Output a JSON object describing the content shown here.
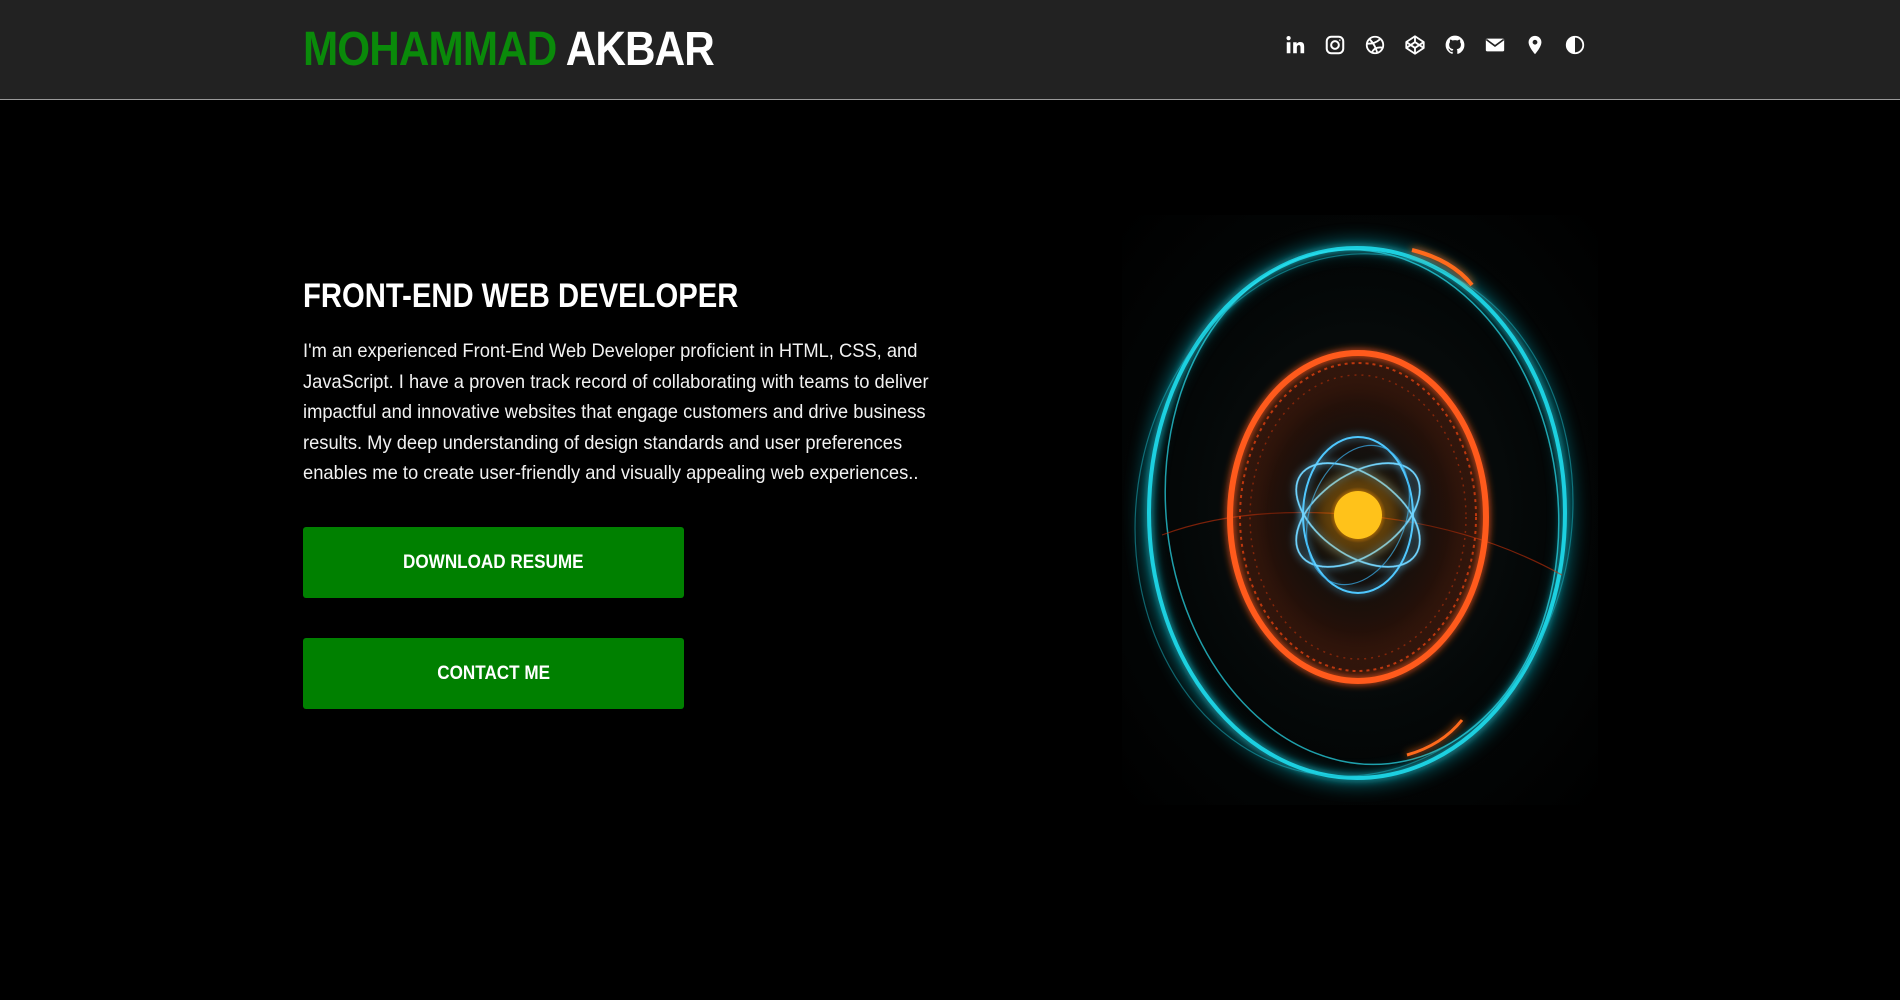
{
  "header": {
    "brand_first": "MOHAMMAD",
    "brand_last": "AKBAR",
    "brand_first_color": "#0a8a0a",
    "icons": [
      "linkedin-icon",
      "instagram-icon",
      "dribbble-icon",
      "codepen-icon",
      "github-icon",
      "email-icon",
      "location-icon",
      "theme-toggle-icon"
    ]
  },
  "hero": {
    "title": "FRONT-END WEB DEVELOPER",
    "description": "I'm an experienced Front-End Web Developer proficient in HTML, CSS, and JavaScript. I have a proven track record of collaborating with teams to deliver impactful and innovative websites that engage customers and drive business results. My deep understanding of design standards and user preferences enables me to create user-friendly and visually appealing web experiences..",
    "buttons": {
      "resume_label": "DOWNLOAD RESUME",
      "contact_label": "CONTACT ME"
    },
    "button_color": "#008000"
  },
  "colors": {
    "background": "#000000",
    "header_bg": "#222222",
    "accent_green": "#008000",
    "cyan_ring": "#1fd0e0",
    "orange_ring": "#ff5a1f",
    "core": "#ffc21a"
  }
}
